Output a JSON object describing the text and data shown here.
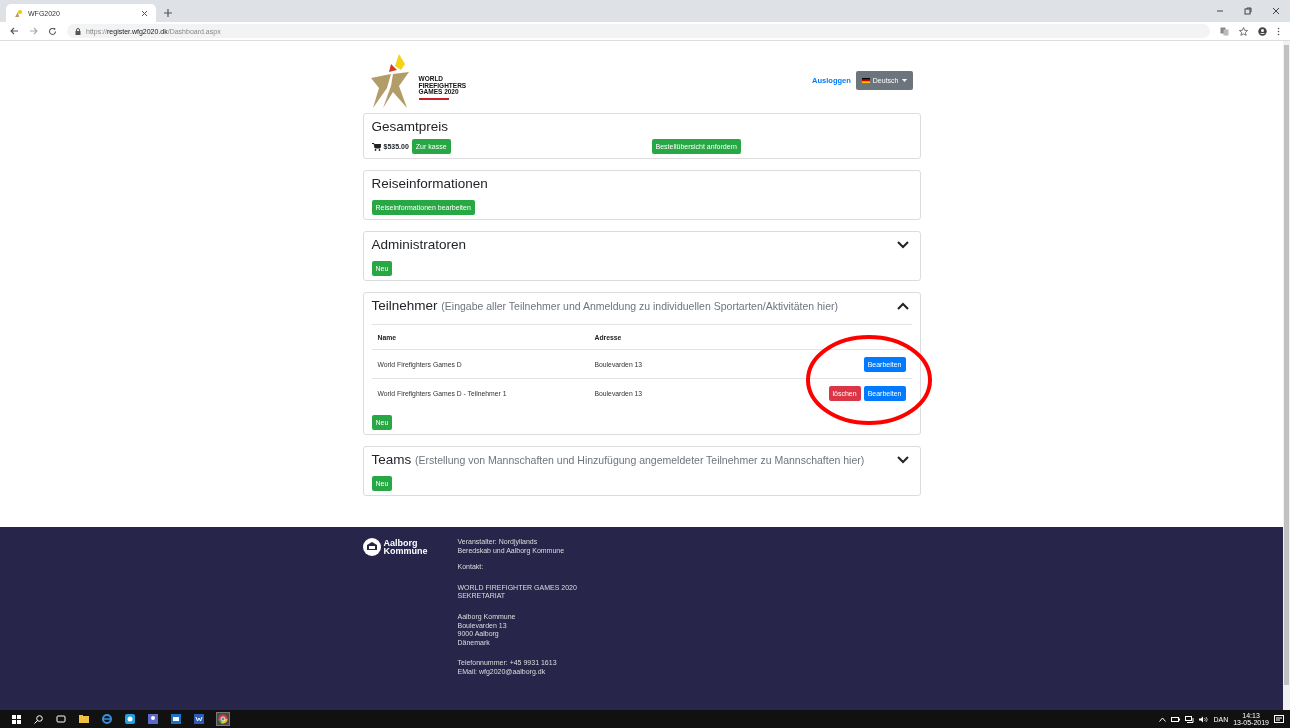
{
  "browser": {
    "tab_title": "WFG2020",
    "url_scheme": "https://",
    "url_host": "register.wfg2020.dk",
    "url_path": "/Dashboard.aspx"
  },
  "header": {
    "logo_lines": [
      "WORLD",
      "FIREFIGHTERS",
      "GAMES 2020"
    ],
    "logout": "Ausloggen",
    "language": "Deutsch"
  },
  "cards": [
    {
      "kind": "price",
      "title": "Gesamtpreis",
      "total": "$535.00",
      "checkout": "Zur kasse",
      "overview": "Bestellübersicht anfordern"
    },
    {
      "kind": "travel",
      "title": "Reiseinformationen",
      "edit": "Reiseinformationen bearbeiten"
    },
    {
      "kind": "list",
      "title": "Administratoren",
      "expanded": false,
      "new": "Neu"
    },
    {
      "kind": "list",
      "title": "Teilnehmer",
      "note": "(Eingabe aller Teilnehmer und Anmeldung zu individuellen Sportarten/Aktivitäten hier)",
      "expanded": true,
      "columns": [
        "Name",
        "Adresse"
      ],
      "rows": [
        {
          "name": "World Firefighters Games D",
          "address": "Boulevarden 13",
          "actions": [
            "Bearbeiten"
          ]
        },
        {
          "name": "World Firefighters Games D - Teilnehmer 1",
          "address": "Boulevarden 13",
          "actions": [
            "löschen",
            "Bearbeiten"
          ]
        }
      ],
      "new": "Neu"
    },
    {
      "kind": "list",
      "title": "Teams",
      "note": "(Erstellung von Mannschaften und Hinzufügung angemeldeter Teilnehmer zu Mannschaften hier)",
      "expanded": false,
      "new": "Neu"
    }
  ],
  "footer": {
    "logo_lines": [
      "Aalborg",
      "Kommune"
    ],
    "blocks": [
      [
        "Veranstalter: Nordjyllands",
        "Beredskab und Aalborg Kommune"
      ],
      [
        "Kontakt:"
      ],
      [
        "WORLD FIREFIGHTER GAMES 2020",
        "SEKRETARIAT"
      ],
      [
        "Aalborg Kommune",
        "Boulevarden 13",
        "9000 Aalborg",
        "Dänemark"
      ],
      [
        "Telefonnummer: +45 9931 1613",
        "EMail: wfg2020@aalborg.dk"
      ]
    ]
  },
  "taskbar": {
    "language": "DAN",
    "time": "14:13",
    "date": "13-05-2019"
  }
}
